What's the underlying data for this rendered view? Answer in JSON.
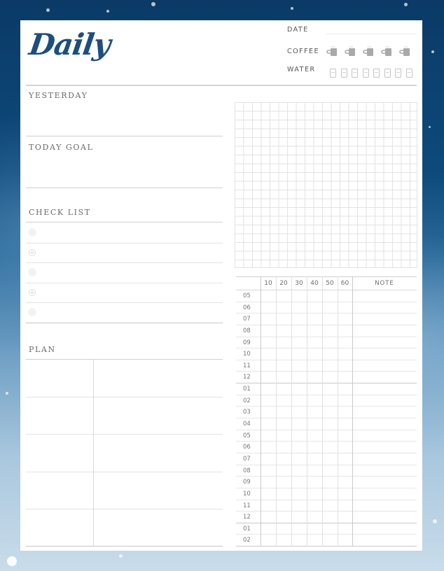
{
  "header": {
    "title": "Daily",
    "date_label": "DATE",
    "date_value": "",
    "coffee_label": "COFFEE",
    "coffee_cups": 5,
    "water_label": "WATER",
    "water_glasses": 8
  },
  "sections": {
    "yesterday": {
      "label": "YESTERDAY",
      "value": ""
    },
    "today_goal": {
      "label": "TODAY GOAL",
      "value": ""
    },
    "check_list": {
      "label": "CHECK LIST",
      "items": [
        "",
        "",
        "",
        "",
        ""
      ]
    },
    "plan": {
      "label": "PLAN",
      "rows": [
        [
          "",
          ""
        ],
        [
          "",
          ""
        ],
        [
          "",
          ""
        ],
        [
          "",
          ""
        ],
        [
          "",
          ""
        ]
      ]
    }
  },
  "time_table": {
    "columns": [
      "10",
      "20",
      "30",
      "40",
      "50",
      "60",
      "NOTE"
    ],
    "hours": [
      "05",
      "06",
      "07",
      "08",
      "09",
      "10",
      "11",
      "12",
      "01",
      "02",
      "03",
      "04",
      "05",
      "06",
      "07",
      "08",
      "09",
      "10",
      "11",
      "12",
      "01",
      "02"
    ]
  },
  "colors": {
    "title": "#1d4e80",
    "background_top": "#0b3a66",
    "background_bottom": "#c9dcea",
    "line": "#cfcfcf"
  }
}
